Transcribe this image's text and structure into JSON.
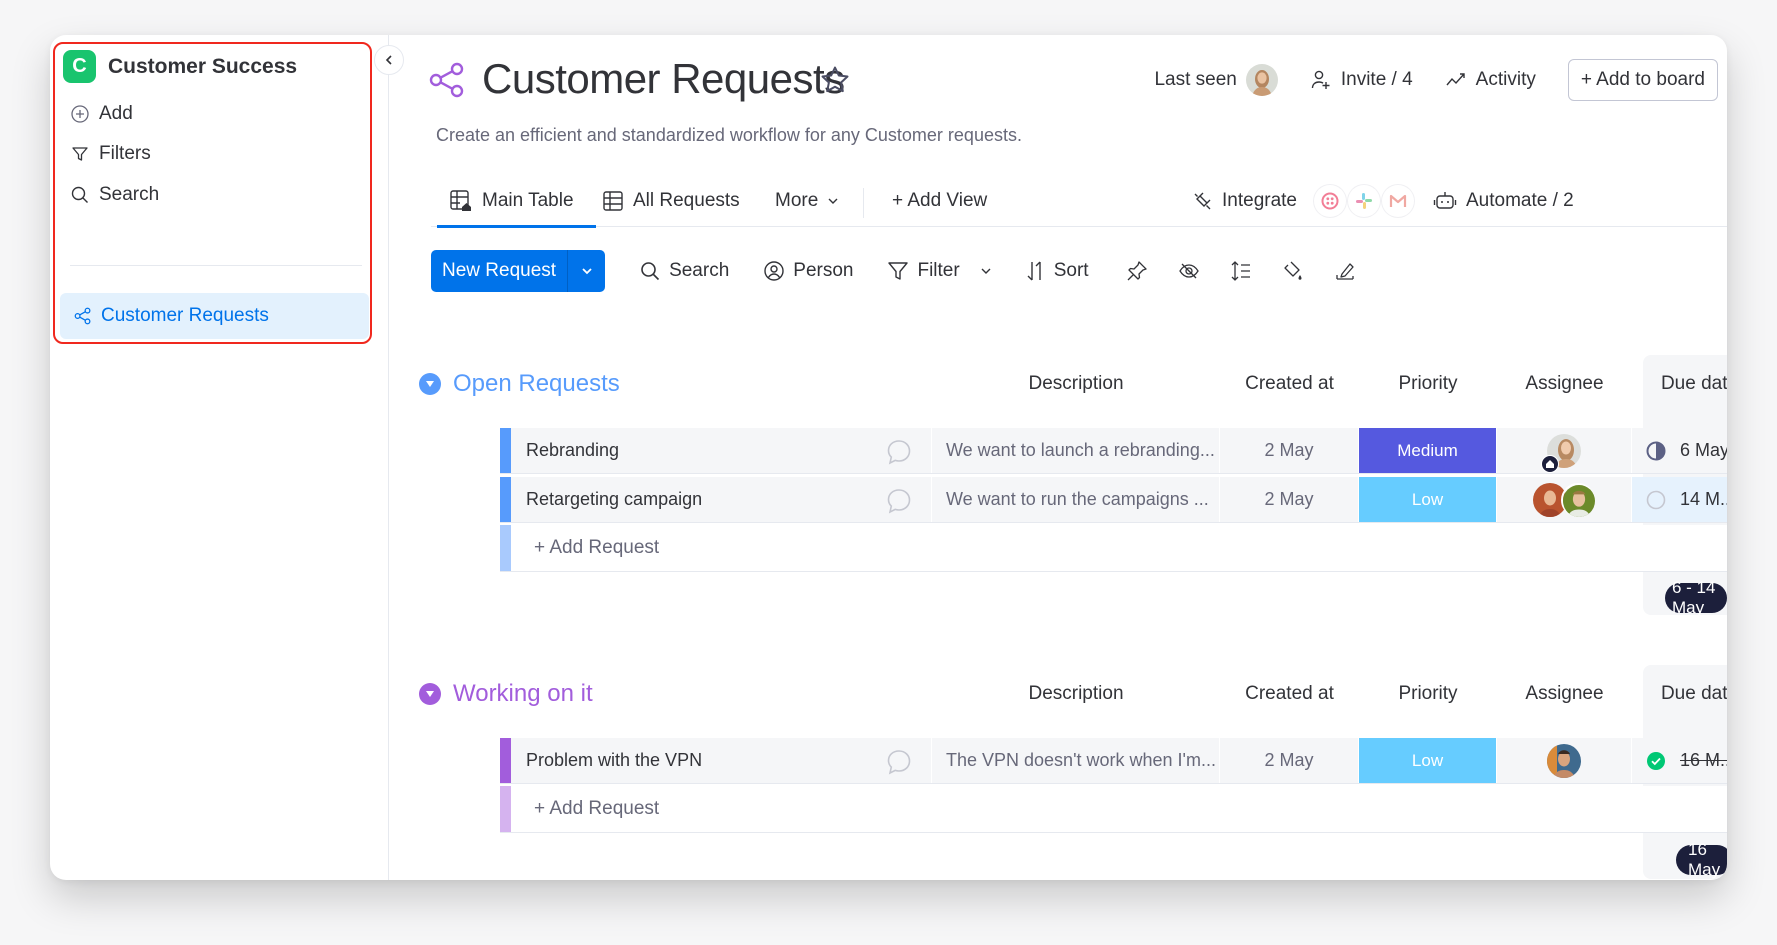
{
  "workspace": {
    "initial": "C",
    "name": "Customer Success",
    "logo_color": "#19c46e"
  },
  "sidebar": {
    "items": [
      {
        "label": "Add",
        "icon": "plus-circle-icon"
      },
      {
        "label": "Filters",
        "icon": "filter-icon"
      },
      {
        "label": "Search",
        "icon": "search-icon"
      }
    ],
    "boards": [
      {
        "label": "Customer Requests",
        "icon": "board-share-icon",
        "selected": true
      }
    ],
    "highlight_color": "#f0281e"
  },
  "board": {
    "title": "Customer Requests",
    "description": "Create an efficient and standardized workflow for any Customer requests.",
    "last_seen_label": "Last seen",
    "invite_label": "Invite / 4",
    "activity_label": "Activity",
    "add_to_board_label": "+ Add to board"
  },
  "views": {
    "tabs": [
      {
        "label": "Main Table",
        "active": true
      },
      {
        "label": "All Requests",
        "active": false
      }
    ],
    "more_label": "More",
    "add_view_label": "+ Add View",
    "integrate_label": "Integrate",
    "integrations": [
      "twilio-icon",
      "slack-icon",
      "gmail-icon"
    ],
    "automate_label": "Automate / 2"
  },
  "toolbar": {
    "new_item_label": "New Request",
    "search_label": "Search",
    "person_label": "Person",
    "filter_label": "Filter",
    "sort_label": "Sort",
    "icons": [
      "pin-icon",
      "hide-icon",
      "row-height-icon",
      "color-fill-icon",
      "format-icon"
    ],
    "accent": "#0073ea"
  },
  "columns": {
    "description": "Description",
    "created_at": "Created at",
    "priority": "Priority",
    "assignee": "Assignee",
    "due_date": "Due date"
  },
  "groups": [
    {
      "title": "Open Requests",
      "color": "#579bfc",
      "add_row_color": "#a9cafd",
      "add_label": "+ Add Request",
      "due_summary": "6 - 14 May",
      "rows": [
        {
          "name": "Rebranding",
          "description": "We want to launch a rebranding...",
          "created_at": "2 May",
          "priority": "Medium",
          "priority_color": "#5559df",
          "assignees": [
            "avatar-woman-blonde"
          ],
          "due_date": "6 May",
          "due_status": "half",
          "due_done": false
        },
        {
          "name": "Retargeting campaign",
          "description": "We want to run the campaigns ...",
          "created_at": "2 May",
          "priority": "Low",
          "priority_color": "#66ccff",
          "assignees": [
            "avatar-woman-red",
            "avatar-man-green"
          ],
          "due_date": "14 M...",
          "due_status": "empty",
          "due_done": false
        }
      ]
    },
    {
      "title": "Working on it",
      "color": "#a25ddc",
      "add_row_color": "#d5b3ef",
      "add_label": "+ Add Request",
      "due_summary": "16 May",
      "rows": [
        {
          "name": "Problem with the VPN",
          "description": "The VPN doesn't work when I'm...",
          "created_at": "2 May",
          "priority": "Low",
          "priority_color": "#66ccff",
          "assignees": [
            "avatar-man-dark"
          ],
          "due_date": "16 M...",
          "due_status": "done",
          "due_done": true
        }
      ]
    }
  ]
}
